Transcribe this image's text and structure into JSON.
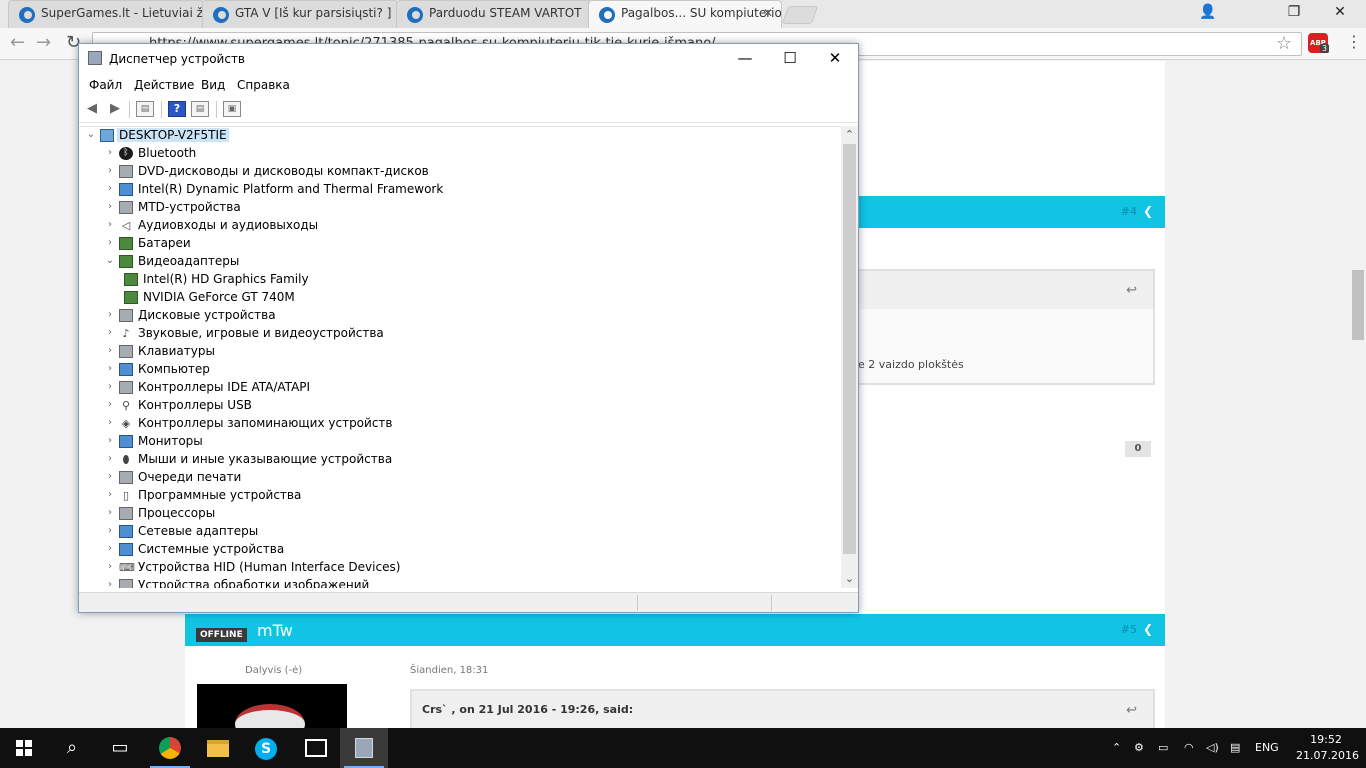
{
  "browser": {
    "tabs": [
      {
        "label": "SuperGames.lt - Lietuviai žaidžia"
      },
      {
        "label": "GTA V [Iš kur parsisiųsti? ]"
      },
      {
        "label": "Parduodu STEAM VARTOT"
      },
      {
        "label": "Pagalbos... SU kompiuterio"
      }
    ],
    "url": "https://www.supergames.lt/topic/271385-pagalbos-su-kompiuteriu-tik-tie-kurie-išmano/",
    "abp_label": "ABP",
    "abp_count": "3"
  },
  "page": {
    "post4_num": "#4",
    "quote_text": "e 2 vaizdo plokštės",
    "count_badge": "0",
    "post5_status": "OFFLINE",
    "post5_user": "mTw",
    "post5_num": "#5",
    "post5_role": "Dalyvis (-ė)",
    "post5_time": "Šiandien, 18:31",
    "post5_quote_head": "Crs` , on 21 Jul 2016 - 19:26, said:"
  },
  "device_manager": {
    "title": "Диспетчер устройств",
    "menu": [
      "Файл",
      "Действие",
      "Вид",
      "Справка"
    ],
    "root": "DESKTOP-V2F5TIE",
    "nodes": [
      {
        "label": "Bluetooth",
        "icon": "bluetooth-icon"
      },
      {
        "label": "DVD-дисководы и дисководы компакт-дисков",
        "icon": "dvd-drive-icon"
      },
      {
        "label": "Intel(R) Dynamic Platform and Thermal Framework",
        "icon": "monitor-icon"
      },
      {
        "label": "MTD-устройства",
        "icon": "mtd-icon"
      },
      {
        "label": "Аудиовходы и аудиовыходы",
        "icon": "speaker-icon"
      },
      {
        "label": "Батареи",
        "icon": "battery-icon"
      },
      {
        "label": "Видеоадаптеры",
        "icon": "display-adapter-icon",
        "expanded": true
      },
      {
        "label": "Intel(R) HD Graphics Family",
        "icon": "display-adapter-icon",
        "child": true
      },
      {
        "label": "NVIDIA GeForce GT 740M",
        "icon": "display-adapter-icon",
        "child": true
      },
      {
        "label": "Дисковые устройства",
        "icon": "disk-drive-icon"
      },
      {
        "label": "Звуковые, игровые и видеоустройства",
        "icon": "sound-icon"
      },
      {
        "label": "Клавиатуры",
        "icon": "keyboard-icon"
      },
      {
        "label": "Компьютер",
        "icon": "computer-icon"
      },
      {
        "label": "Контроллеры IDE ATA/ATAPI",
        "icon": "ide-controller-icon"
      },
      {
        "label": "Контроллеры USB",
        "icon": "usb-icon"
      },
      {
        "label": "Контроллеры запоминающих устройств",
        "icon": "storage-controller-icon"
      },
      {
        "label": "Мониторы",
        "icon": "monitor-icon"
      },
      {
        "label": "Мыши и иные указывающие устройства",
        "icon": "mouse-icon"
      },
      {
        "label": "Очереди печати",
        "icon": "printer-icon"
      },
      {
        "label": "Программные устройства",
        "icon": "software-device-icon"
      },
      {
        "label": "Процессоры",
        "icon": "processor-icon"
      },
      {
        "label": "Сетевые адаптеры",
        "icon": "network-adapter-icon"
      },
      {
        "label": "Системные устройства",
        "icon": "system-device-icon"
      },
      {
        "label": "Устройства HID (Human Interface Devices)",
        "icon": "hid-icon"
      },
      {
        "label": "Устройства обработки изображений",
        "icon": "imaging-device-icon"
      }
    ]
  },
  "taskbar": {
    "language": "ENG",
    "time": "19:52",
    "date": "21.07.2016"
  }
}
